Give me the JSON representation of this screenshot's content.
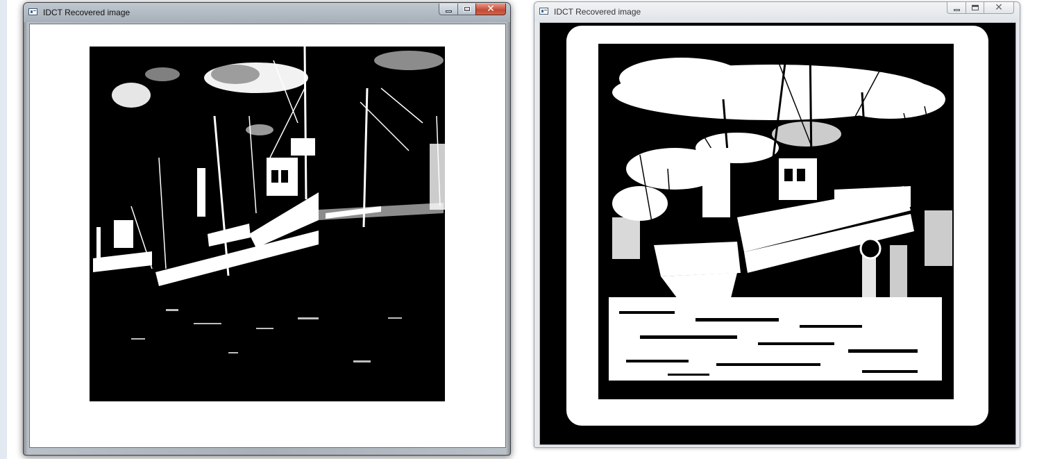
{
  "windows": [
    {
      "title": "IDCT Recovered image",
      "state": "active",
      "image": "binarized harbor fishing boats (mostly black)"
    },
    {
      "title": "IDCT Recovered image",
      "state": "inactive",
      "image": "binarized harbor fishing boats with white frame and black border"
    }
  ],
  "icons": {
    "app": "app-window-icon",
    "minimize": "minimize-icon",
    "maximize": "maximize-icon",
    "close": "close-icon"
  },
  "colors": {
    "active_titlebar": "#a7b0ba",
    "inactive_titlebar": "#e1e4e8",
    "close_button": "#c24a34",
    "image_dark": "#000000",
    "image_light": "#ffffff"
  }
}
